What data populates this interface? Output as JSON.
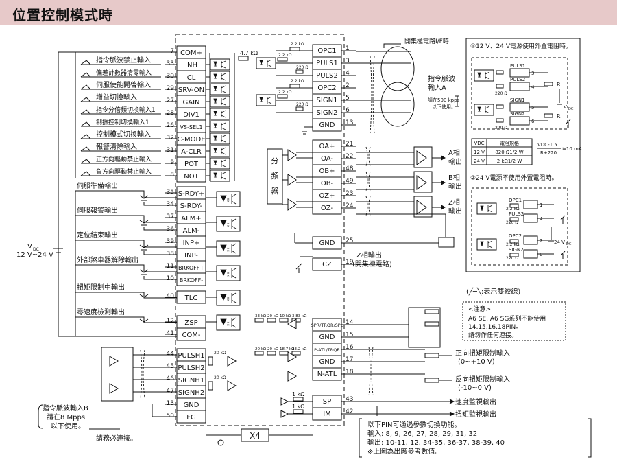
{
  "page_title": "位置控制模式時",
  "supply": {
    "vdc": "V",
    "vdc_sub": "DC",
    "range": "12 V~24 V"
  },
  "left_inputs": [
    {
      "label": "指令脈波禁止輸入",
      "pin": "33",
      "signal": "INH"
    },
    {
      "label": "偏差計數器清零輸入",
      "pin": "30",
      "signal": "CL"
    },
    {
      "label": "伺服使能開啓輸入",
      "pin": "29",
      "signal": "SRV-ON"
    },
    {
      "label": "增益切換輸入",
      "pin": "27",
      "signal": "GAIN"
    },
    {
      "label": "指令分倍頻切換輸入1",
      "pin": "28",
      "signal": "DIV1"
    },
    {
      "label": "制振控制切換輸入1",
      "pin": "26",
      "signal": "VS-SEL1"
    },
    {
      "label": "控制模式切換輸入",
      "pin": "32",
      "signal": "C-MODE"
    },
    {
      "label": "報警清除輸入",
      "pin": "31",
      "signal": "A-CLR"
    },
    {
      "label": "正方向驅動禁止輸入",
      "pin": "9",
      "signal": "POT"
    },
    {
      "label": "負方向驅動禁止輸入",
      "pin": "8",
      "signal": "NOT"
    }
  ],
  "com_plus": {
    "pin": "7",
    "signal": "COM+"
  },
  "resistor_47k": "4.7 kΩ",
  "left_outputs": [
    {
      "label": "伺服準備輸出",
      "pins": [
        "35",
        "34"
      ],
      "signals": [
        "S-RDY+",
        "S-RDY-"
      ]
    },
    {
      "label": "伺服報警輸出",
      "pins": [
        "37",
        "36"
      ],
      "signals": [
        "ALM+",
        "ALM-"
      ]
    },
    {
      "label": "定位結束輸出",
      "pins": [
        "39",
        "38"
      ],
      "signals": [
        "INP+",
        "INP-"
      ]
    },
    {
      "label": "外部煞車器解除輸出",
      "pins": [
        "11",
        "10"
      ],
      "signals": [
        "BRKOFF+",
        "BRKOFF-"
      ]
    }
  ],
  "tlc": {
    "label": "扭矩限制中輸出",
    "pin": "40",
    "signal": "TLC"
  },
  "zsp": {
    "label": "零速度檢測輸出",
    "pin": "12",
    "signal": "ZSP"
  },
  "com_minus": {
    "pin": "41",
    "signal": "COM-"
  },
  "pulse_b": [
    {
      "pin": "44",
      "signal": "PULSH1"
    },
    {
      "pin": "45",
      "signal": "PULSH2"
    },
    {
      "pin": "46",
      "signal": "SIGNH1"
    },
    {
      "pin": "47",
      "signal": "SIGNH2"
    },
    {
      "pin": "13",
      "signal": "GND"
    },
    {
      "pin": "50",
      "signal": "FG"
    }
  ],
  "pulse_b_note": [
    "指令脈波輸入B",
    "請在8 Mpps",
    "以下使用。"
  ],
  "connect_note": "請務必連接。",
  "connector": "X4",
  "right_top": [
    {
      "pin": "1",
      "signal": "OPC1"
    },
    {
      "pin": "3",
      "signal": "PULS1"
    },
    {
      "pin": "4",
      "signal": "PULS2"
    },
    {
      "pin": "2",
      "signal": "OPC2"
    },
    {
      "pin": "5",
      "signal": "SIGN1"
    },
    {
      "pin": "6",
      "signal": "SIGN2"
    },
    {
      "pin": "13",
      "signal": "GND"
    }
  ],
  "res_22k": "2.2 kΩ",
  "res_220": "220 Ω",
  "open_collector_label": "開集極電路I/F時",
  "pulse_a_note": [
    "指令脈波",
    "輸入A"
  ],
  "pulse_a_small": [
    "請在500 kpps",
    "以下使用。"
  ],
  "encoder": [
    {
      "pin": "21",
      "signal": "OA+"
    },
    {
      "pin": "22",
      "signal": "OA-"
    },
    {
      "pin": "48",
      "signal": "OB+"
    },
    {
      "pin": "49",
      "signal": "OB-"
    },
    {
      "pin": "23",
      "signal": "OZ+"
    },
    {
      "pin": "24",
      "signal": "OZ-"
    }
  ],
  "divider": "分頻器",
  "phase_outputs": [
    [
      "A相",
      "輸出"
    ],
    [
      "B相",
      "輸出"
    ],
    [
      "Z相",
      "輸出"
    ]
  ],
  "gnd25": {
    "pin": "25",
    "signal": "GND"
  },
  "cz": {
    "pin": "19",
    "signal": "CZ"
  },
  "z_open": [
    "Z相輸出",
    "(開集極電路)"
  ],
  "analog": [
    {
      "pin": "14",
      "signal": "SPR/TRQR/SPL"
    },
    {
      "pin": "15",
      "signal": "GND"
    },
    {
      "pin": "16",
      "signal": "P-ATL/TRQR"
    },
    {
      "pin": "17",
      "signal": "GND"
    },
    {
      "pin": "18",
      "signal": "N-ATL"
    }
  ],
  "analog_res": [
    "33 kΩ",
    "20 kΩ",
    "10 kΩ",
    "3.83 kΩ",
    "20 kΩ",
    "20 kΩ",
    "18.7 kΩ",
    "33.2 kΩ"
  ],
  "torque_fwd": [
    "正向扭矩限制輸入",
    "(0~+10 V)"
  ],
  "torque_rev": [
    "反向扭矩限制輸入",
    "(-10~0 V)"
  ],
  "monitors": [
    {
      "pin": "43",
      "signal": "SP",
      "label": "速度監視輸出",
      "res": "1 kΩ"
    },
    {
      "pin": "42",
      "signal": "IM",
      "label": "扭矩監視輸出",
      "res": "1 kΩ"
    }
  ],
  "twisted_note": "(╱─╲:表示雙絞線)",
  "note": {
    "head": "<注意>",
    "lines": [
      "A6 SE, A6 SG系列不能使用",
      "14,15,16,18PIN。",
      "請勿作任何連接。"
    ]
  },
  "pin_note": [
    "以下PIN可通過參數切換功能。",
    "輸入: 8, 9, 26, 27, 28, 29, 31, 32",
    "輸出: 10-11, 12, 34-35, 36-37, 38-39, 40",
    "※上圖為出廠參考數值。"
  ],
  "inset1": {
    "title": "①12 V、24 V電源使用外置電阻時。",
    "signals": [
      "PULS1",
      "PULS2",
      "SIGN1",
      "SIGN2"
    ],
    "pins": [
      "3",
      "4",
      "5",
      "6"
    ],
    "res": "220 Ω",
    "r_label": "R",
    "vdc_label": "V",
    "vdc_sub": "DC",
    "table": {
      "headers": [
        "VDC",
        "電阻規格"
      ],
      "rows": [
        [
          "12 V",
          "820 Ω1/2 W"
        ],
        [
          "24 V",
          "2 kΩ1/2 W"
        ]
      ]
    },
    "formula": "VDC-1.5 / R+220 ≒10 mA"
  },
  "inset2": {
    "title": "②24 V電源不使用外置電阻時。",
    "signals": [
      "OPC1",
      "PULS2",
      "OPC2",
      "SIGN2"
    ],
    "pins": [
      "1",
      "4",
      "2",
      "6"
    ],
    "res": [
      "2.2 kΩ",
      "220 Ω"
    ],
    "vdc": "24 V",
    "vdc_sub": "DC"
  }
}
